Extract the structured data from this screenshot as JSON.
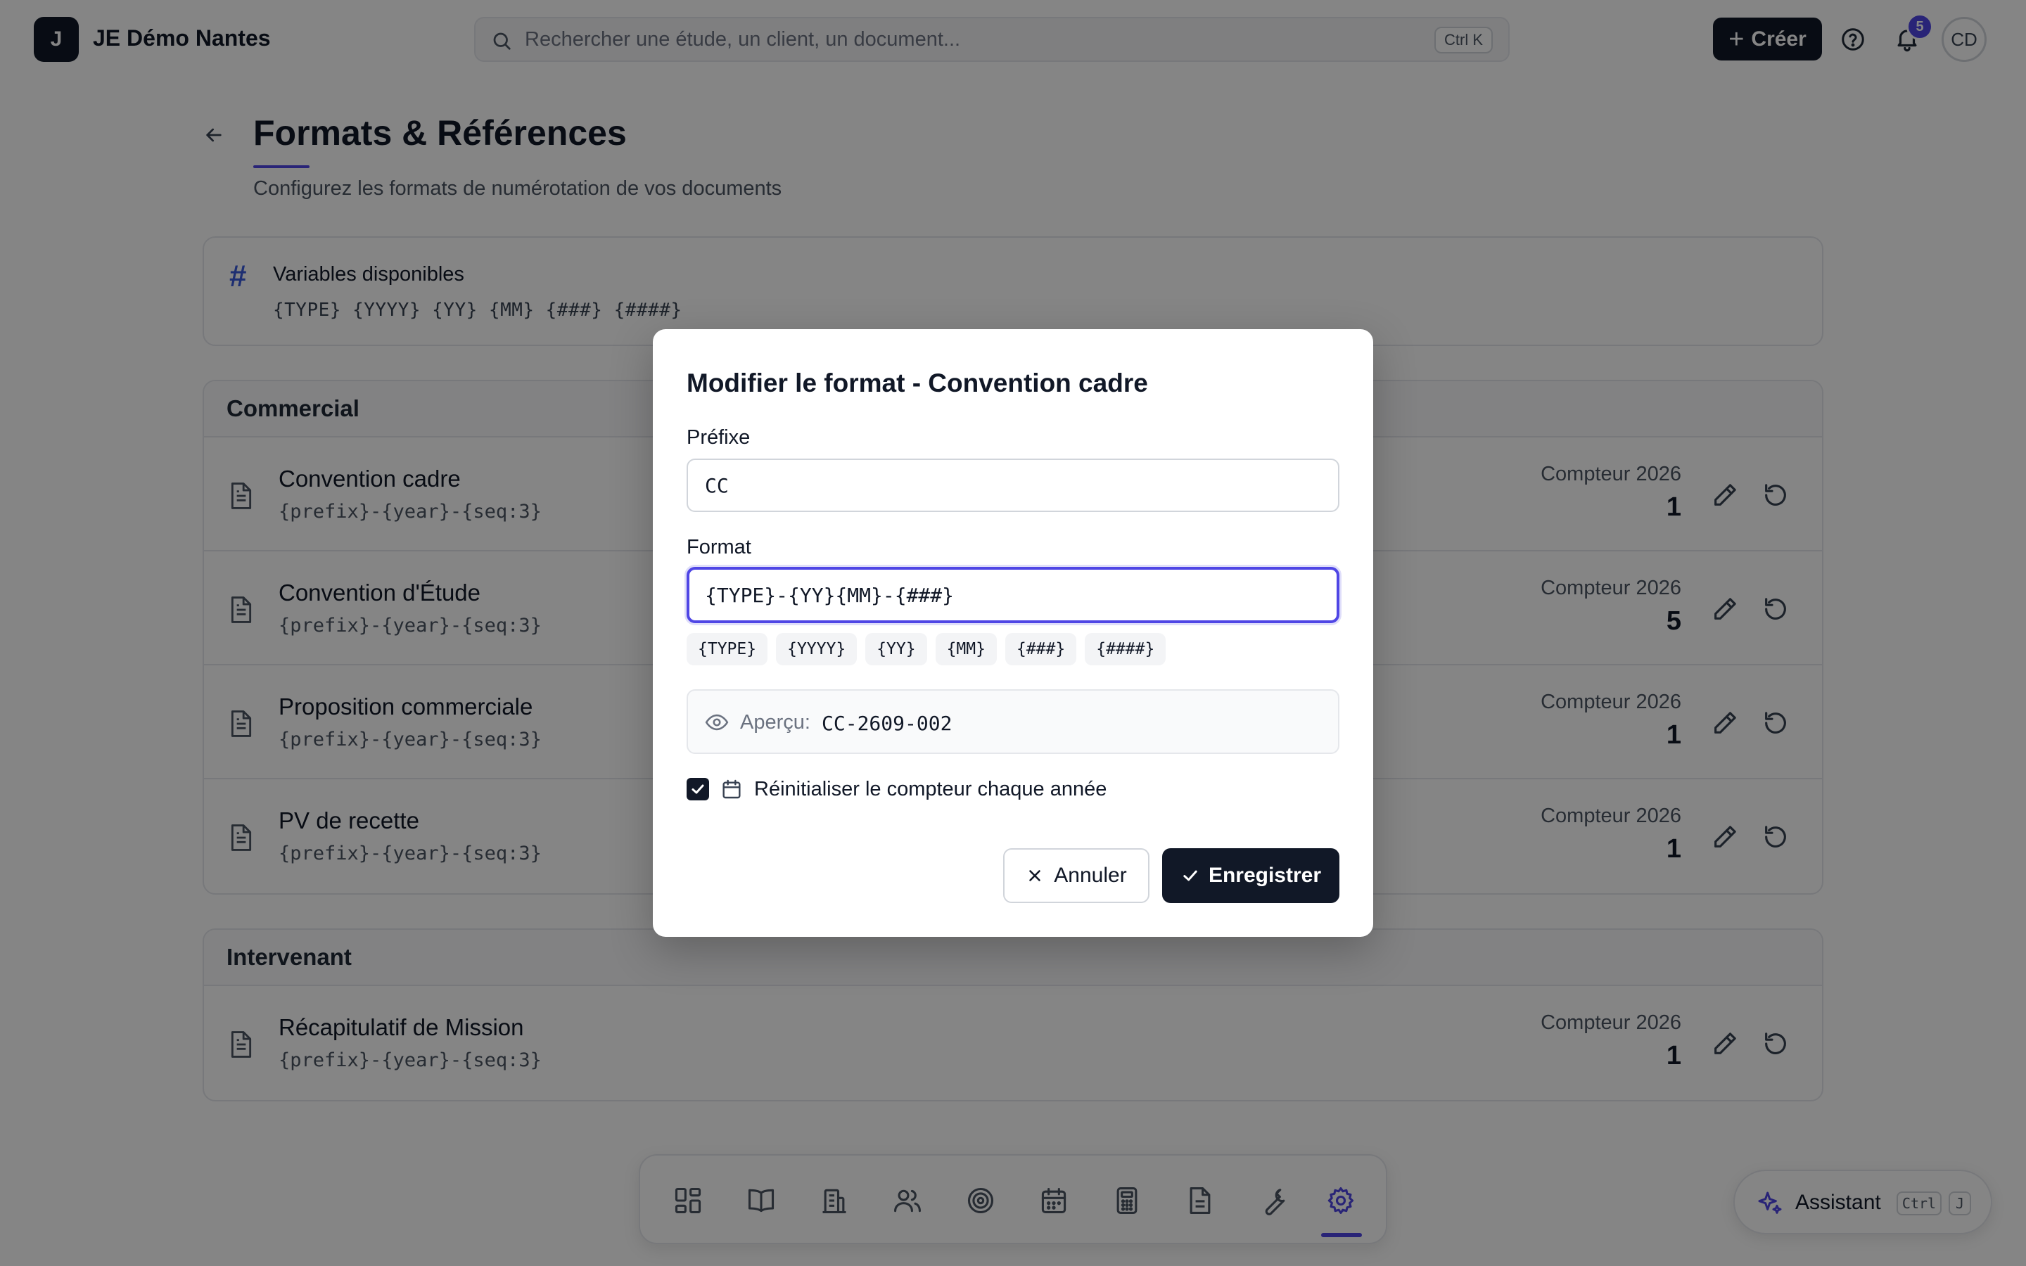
{
  "app": {
    "logo_letter": "J",
    "brand": "JE Démo Nantes",
    "search_placeholder": "Rechercher une étude, un client, un document...",
    "search_shortcut": "Ctrl K",
    "create_label": "Créer",
    "notification_count": "5",
    "avatar_initials": "CD"
  },
  "page": {
    "title": "Formats & Références",
    "subtitle": "Configurez les formats de numérotation de vos documents"
  },
  "variables": {
    "icon": "#",
    "title": "Variables disponibles",
    "list": "{TYPE} {YYYY} {YY} {MM} {###} {####}"
  },
  "sections": [
    {
      "title": "Commercial",
      "items": [
        {
          "name": "Convention cadre",
          "format": "{prefix}-{year}-{seq:3}",
          "counter_label": "Compteur 2026",
          "counter": "1"
        },
        {
          "name": "Convention d'Étude",
          "format": "{prefix}-{year}-{seq:3}",
          "counter_label": "Compteur 2026",
          "counter": "5"
        },
        {
          "name": "Proposition commerciale",
          "format": "{prefix}-{year}-{seq:3}",
          "counter_label": "Compteur 2026",
          "counter": "1"
        },
        {
          "name": "PV de recette",
          "format": "{prefix}-{year}-{seq:3}",
          "counter_label": "Compteur 2026",
          "counter": "1"
        }
      ]
    },
    {
      "title": "Intervenant",
      "items": [
        {
          "name": "Récapitulatif de Mission",
          "format": "{prefix}-{year}-{seq:3}",
          "counter_label": "Compteur 2026",
          "counter": "1"
        }
      ]
    }
  ],
  "modal": {
    "title": "Modifier le format - Convention cadre",
    "prefix_label": "Préfixe",
    "prefix_value": "CC",
    "format_label": "Format",
    "format_value": "{TYPE}-{YY}{MM}-{###}",
    "chips": [
      "{TYPE}",
      "{YYYY}",
      "{YY}",
      "{MM}",
      "{###}",
      "{####}"
    ],
    "preview_label": "Aperçu:",
    "preview_value": "CC-2609-002",
    "reset_checkbox_label": "Réinitialiser le compteur chaque année",
    "reset_checked": true,
    "cancel_label": "Annuler",
    "save_label": "Enregistrer"
  },
  "dock": {
    "items": [
      "dashboard-icon",
      "book-icon",
      "building-icon",
      "users-icon",
      "target-icon",
      "calendar-icon",
      "calculator-icon",
      "document-icon",
      "wrench-icon",
      "settings-icon"
    ],
    "active": "settings-icon"
  },
  "assistant": {
    "label": "Assistant",
    "key1": "Ctrl",
    "key2": "J"
  },
  "colors": {
    "accent": "#4f46e5",
    "primary_button": "#111827",
    "overlay": "rgba(0,0,0,0.48)"
  }
}
